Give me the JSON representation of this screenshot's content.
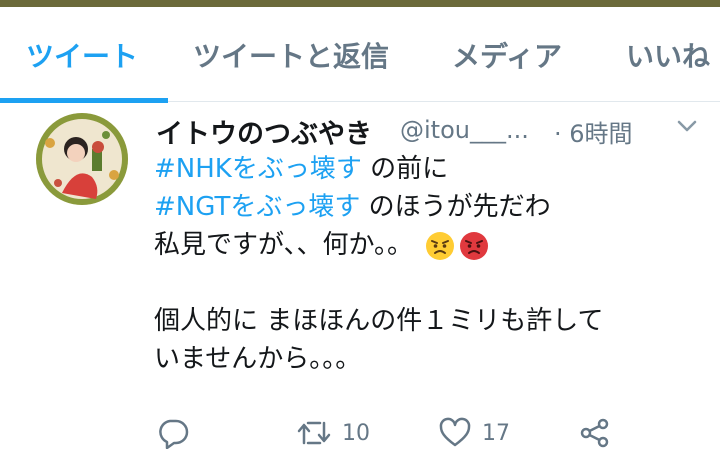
{
  "tabs": [
    {
      "label": "ツイート",
      "active": true
    },
    {
      "label": "ツイートと返信",
      "active": false
    },
    {
      "label": "メディア",
      "active": false
    },
    {
      "label": "いいね",
      "active": false
    }
  ],
  "tweet": {
    "display_name": "イトウのつぶやき",
    "handle": "@itou___...",
    "time": "· 6時間",
    "lines": [
      {
        "tag": "#NHKをぶっ壊す",
        "text": " の前に"
      },
      {
        "tag": "#NGTをぶっ壊す",
        "text": " のほうが先だわ"
      },
      {
        "text": "私見ですが、、何か。。"
      },
      {
        "text": ""
      },
      {
        "text": "個人的に まほほんの件１ミリも許して"
      },
      {
        "text": "いませんから。。。"
      }
    ],
    "emojis": [
      "angry-face",
      "pouting-face"
    ],
    "replies": "",
    "retweets": "10",
    "likes": "17"
  },
  "colors": {
    "accent": "#1da1f2",
    "muted": "#657786",
    "text": "#14171a",
    "topbar": "#6b6a3a"
  }
}
